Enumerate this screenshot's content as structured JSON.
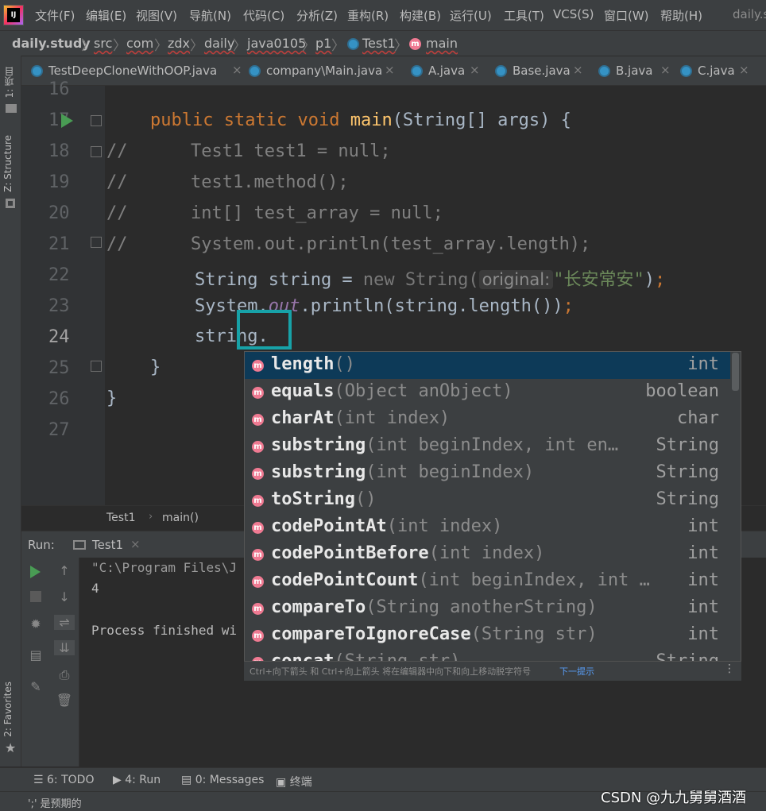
{
  "menubar": {
    "items": [
      "文件(F)",
      "编辑(E)",
      "视图(V)",
      "导航(N)",
      "代码(C)",
      "分析(Z)",
      "重构(R)",
      "构建(B)",
      "运行(U)",
      "工具(T)",
      "VCS(S)",
      "窗口(W)",
      "帮助(H)"
    ],
    "title": "daily.s"
  },
  "breadcrumb": {
    "items": [
      "daily.study",
      "src",
      "com",
      "zdx",
      "daily",
      "java0105",
      "p1",
      "Test1",
      "main"
    ]
  },
  "tabs": [
    "TestDeepCloneWithOOP.java",
    "company\\Main.java",
    "A.java",
    "Base.java",
    "B.java",
    "C.java"
  ],
  "left_tool_windows": {
    "project": "1: 项目",
    "structure": "Z: Structure",
    "favorites": "2: Favorites"
  },
  "editor": {
    "line_numbers": [
      "16",
      "17",
      "18",
      "19",
      "20",
      "21",
      "22",
      "23",
      "24",
      "25",
      "26",
      "27"
    ],
    "lines": {
      "l17": {
        "pub": "public",
        "stat": "static",
        "void": "void",
        "name": "main",
        "rest": "(String[] args) {"
      },
      "l18": {
        "cm": "//",
        "code": "Test1 test1 = null;"
      },
      "l19": {
        "cm": "//",
        "code": "test1.method();"
      },
      "l20": {
        "cm": "//",
        "code": "int[] test_array = null;"
      },
      "l21": {
        "cm": "//",
        "code": "System.out.println(test_array.length);"
      },
      "l22": {
        "a": "String string = ",
        "new": "new",
        "b": " String(",
        "hint": "original:",
        "str": "\"长安常安\"",
        "c": ")",
        "semi": ";"
      },
      "l23": {
        "a": "System.",
        "out": "out",
        "b": ".println(string.length())",
        "semi": ";"
      },
      "l24": {
        "a": "string."
      },
      "l25": {
        "a": "}"
      },
      "l26": {
        "a": "}"
      }
    },
    "crumb": {
      "cls": "Test1",
      "method": "main()"
    }
  },
  "suggestions": [
    {
      "name": "length",
      "params": "()",
      "type": "int"
    },
    {
      "name": "equals",
      "params": "(Object anObject)",
      "type": "boolean"
    },
    {
      "name": "charAt",
      "params": "(int index)",
      "type": "char"
    },
    {
      "name": "substring",
      "params": "(int beginIndex, int en…",
      "type": "String"
    },
    {
      "name": "substring",
      "params": "(int beginIndex)",
      "type": "String"
    },
    {
      "name": "toString",
      "params": "()",
      "type": "String"
    },
    {
      "name": "codePointAt",
      "params": "(int index)",
      "type": "int"
    },
    {
      "name": "codePointBefore",
      "params": "(int index)",
      "type": "int"
    },
    {
      "name": "codePointCount",
      "params": "(int beginIndex, int …",
      "type": "int"
    },
    {
      "name": "compareTo",
      "params": "(String anotherString)",
      "type": "int"
    },
    {
      "name": "compareToIgnoreCase",
      "params": "(String str)",
      "type": "int"
    },
    {
      "name": "concat",
      "params": "(String str)",
      "type": "String"
    }
  ],
  "popup_footer": {
    "hint": "Ctrl+向下箭头 和 Ctrl+向上箭头 将在编辑器中向下和向上移动脱字符号",
    "link": "下一提示"
  },
  "run_panel": {
    "label": "Run:",
    "tab": "Test1",
    "lines": [
      "\"C:\\Program Files\\J",
      "4",
      "",
      "Process finished wi"
    ]
  },
  "bottom_tabs": {
    "todo": "6: TODO",
    "run": "4: Run",
    "messages": "0: Messages",
    "terminal": "终端"
  },
  "status": {
    "text": "';' 是预期的"
  },
  "watermark": "CSDN @九九舅舅酒酒",
  "colors": {
    "keyword": "#cc7832",
    "method": "#ffc66d",
    "string": "#6a8759",
    "comment": "#808080",
    "field": "#9876aa",
    "selection": "#0d3a58",
    "cursor_box": "#17a2a8"
  }
}
